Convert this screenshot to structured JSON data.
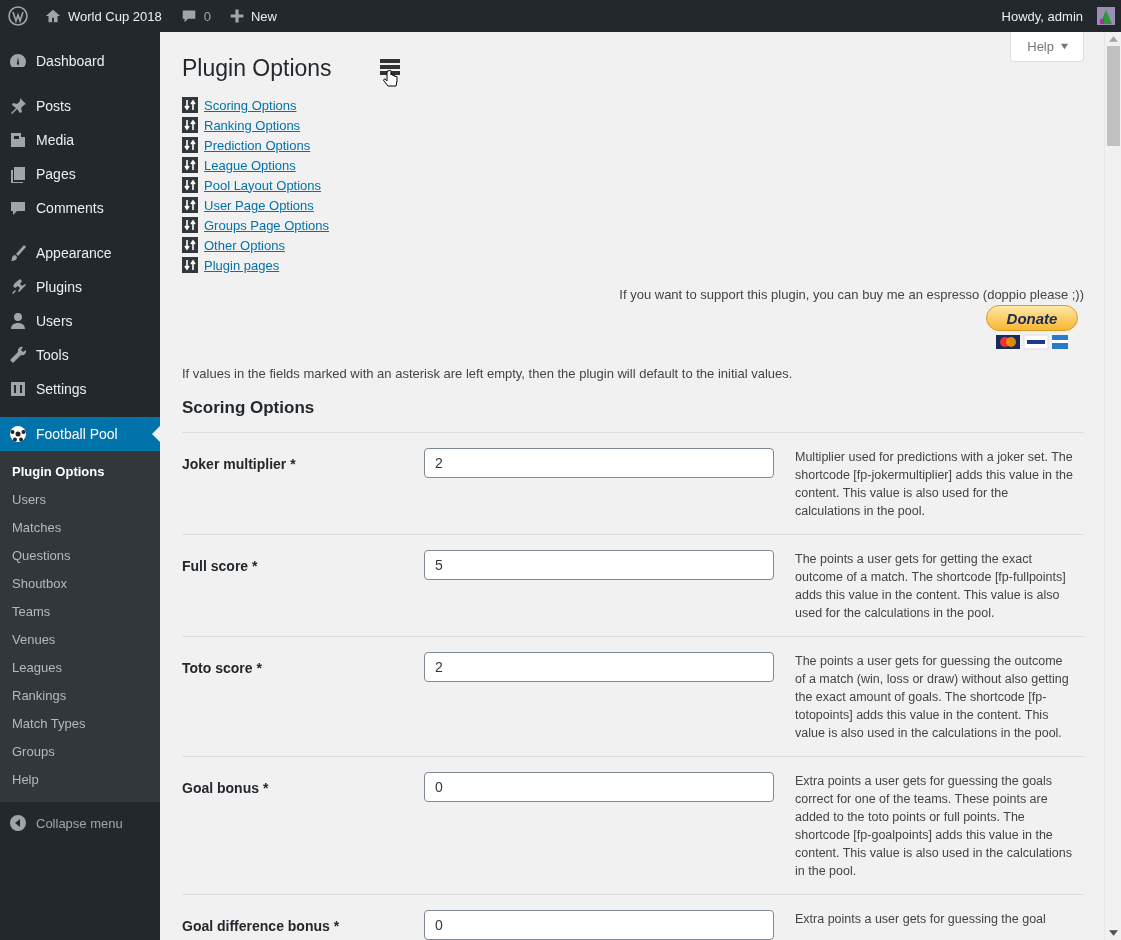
{
  "admin_bar": {
    "site_name": "World Cup 2018",
    "comments_count": "0",
    "new_label": "New",
    "greeting": "Howdy, admin"
  },
  "sidebar": {
    "items": [
      {
        "label": "Dashboard",
        "selected": false
      },
      {
        "label": "Posts",
        "selected": false
      },
      {
        "label": "Media",
        "selected": false
      },
      {
        "label": "Pages",
        "selected": false
      },
      {
        "label": "Comments",
        "selected": false
      },
      {
        "label": "Appearance",
        "selected": false
      },
      {
        "label": "Plugins",
        "selected": false
      },
      {
        "label": "Users",
        "selected": false
      },
      {
        "label": "Tools",
        "selected": false
      },
      {
        "label": "Settings",
        "selected": false
      },
      {
        "label": "Football Pool",
        "selected": true
      }
    ],
    "submenu": [
      {
        "label": "Plugin Options",
        "selected": true
      },
      {
        "label": "Users",
        "selected": false
      },
      {
        "label": "Matches",
        "selected": false
      },
      {
        "label": "Questions",
        "selected": false
      },
      {
        "label": "Shoutbox",
        "selected": false
      },
      {
        "label": "Teams",
        "selected": false
      },
      {
        "label": "Venues",
        "selected": false
      },
      {
        "label": "Leagues",
        "selected": false
      },
      {
        "label": "Rankings",
        "selected": false
      },
      {
        "label": "Match Types",
        "selected": false
      },
      {
        "label": "Groups",
        "selected": false
      },
      {
        "label": "Help",
        "selected": false
      }
    ],
    "collapse_label": "Collapse menu"
  },
  "help_button": "Help",
  "page_title": "Plugin Options",
  "section_links": [
    "Scoring Options",
    "Ranking Options",
    "Prediction Options",
    "League Options",
    "Pool Layout Options",
    "User Page Options",
    "Groups Page Options",
    "Other Options",
    "Plugin pages"
  ],
  "donate": {
    "text": "If you want to support this plugin, you can buy me an espresso (doppio please ;))",
    "button": "Donate"
  },
  "note": "If values in the fields marked with an asterisk are left empty, then the plugin will default to the initial values.",
  "section_title": "Scoring Options",
  "fields": [
    {
      "label": "Joker multiplier *",
      "value": "2",
      "description": "Multiplier used for predictions with a joker set. The shortcode [fp-jokermultiplier] adds this value in the content. This value is also used for the calculations in the pool."
    },
    {
      "label": "Full score *",
      "value": "5",
      "description": "The points a user gets for getting the exact outcome of a match. The shortcode [fp-fullpoints] adds this value in the content. This value is also used for the calculations in the pool."
    },
    {
      "label": "Toto score *",
      "value": "2",
      "description": "The points a user gets for guessing the outcome of a match (win, loss or draw) without also getting the exact amount of goals. The shortcode [fp-totopoints] adds this value in the content. This value is also used in the calculations in the pool."
    },
    {
      "label": "Goal bonus *",
      "value": "0",
      "description": "Extra points a user gets for guessing the goals correct for one of the teams. These points are added to the toto points or full points. The shortcode [fp-goalpoints] adds this value in the content. This value is also used in the calculations in the pool."
    },
    {
      "label": "Goal difference bonus *",
      "value": "0",
      "description": "Extra points a user gets for guessing the goal"
    }
  ]
}
